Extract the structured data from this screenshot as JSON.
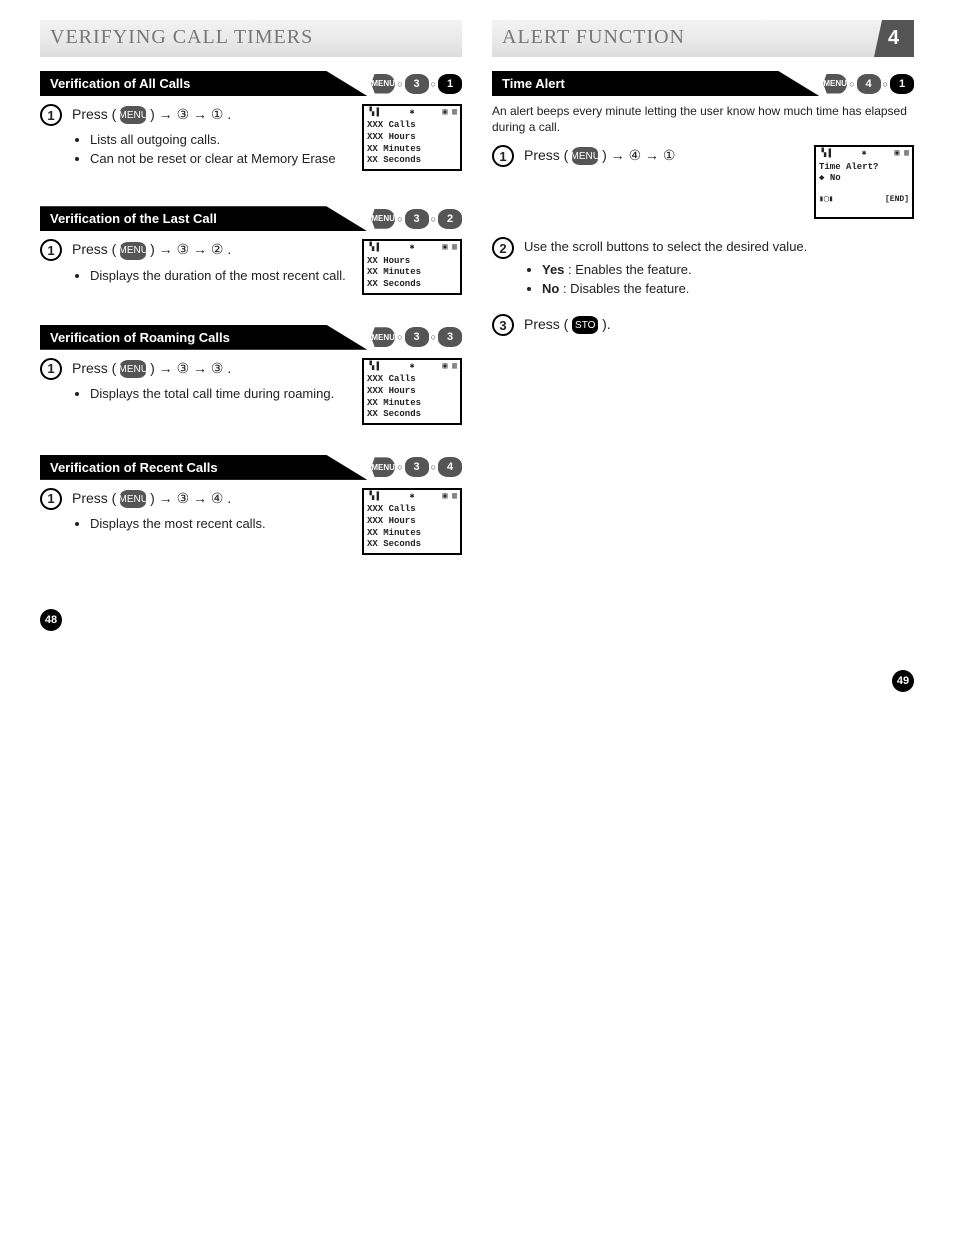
{
  "left": {
    "header": "VERIFYING CALL TIMERS",
    "pagenum": "48",
    "sections": [
      {
        "title": "Verification of All Calls",
        "keys": [
          "MENU",
          "3",
          "1"
        ],
        "steps": [
          {
            "num": "1",
            "press": "Press ( MENU ) → ③ → ① .",
            "bullets": [
              "Lists all outgoing calls.",
              "Can not be reset or clear at Memory Erase"
            ],
            "screen": [
              "XXX Calls",
              "XXX Hours",
              "XX  Minutes",
              "XX  Seconds"
            ]
          }
        ]
      },
      {
        "title": "Verification of the Last Call",
        "keys": [
          "MENU",
          "3",
          "2"
        ],
        "steps": [
          {
            "num": "1",
            "press": "Press ( MENU ) → ③ → ② .",
            "bullets": [
              "Displays the duration of the most recent call."
            ],
            "screen": [
              "XX  Hours",
              "XX  Minutes",
              "XX  Seconds"
            ]
          }
        ]
      },
      {
        "title": "Verification of Roaming Calls",
        "keys": [
          "MENU",
          "3",
          "3"
        ],
        "steps": [
          {
            "num": "1",
            "press": "Press ( MENU ) → ③ → ③ .",
            "bullets": [
              "Displays the total call time during roaming."
            ],
            "screen": [
              "XXX Calls",
              "XXX Hours",
              "XX  Minutes",
              "XX  Seconds"
            ]
          }
        ]
      },
      {
        "title": "Verification of Recent Calls",
        "keys": [
          "MENU",
          "3",
          "4"
        ],
        "steps": [
          {
            "num": "1",
            "press": "Press ( MENU ) → ③ → ④ .",
            "bullets": [
              "Displays the most recent calls."
            ],
            "screen": [
              "XXX Calls",
              "XXX Hours",
              "XX  Minutes",
              "XX  Seconds"
            ]
          }
        ]
      }
    ]
  },
  "right": {
    "header": "ALERT FUNCTION",
    "pagenum": "49",
    "section": {
      "title": "Time Alert",
      "keys": [
        "MENU",
        "4",
        "1"
      ],
      "intro": "An alert beeps every minute letting the user know how much time has elapsed during a call.",
      "steps": [
        {
          "num": "1",
          "press": "Press ( MENU ) → ④ → ①",
          "screen": {
            "title": "Time Alert?",
            "value": "◆ No",
            "end": "[END]"
          }
        },
        {
          "num": "2",
          "text": "Use the scroll buttons to select the desired value.",
          "bullets": [
            "Yes : Enables the feature.",
            "No : Disables the feature."
          ]
        },
        {
          "num": "3",
          "press": "Press ( STO )."
        }
      ]
    }
  },
  "screen_top": {
    "l": "▝▖▌",
    "m": "✱",
    "r": "▣ ▥"
  }
}
